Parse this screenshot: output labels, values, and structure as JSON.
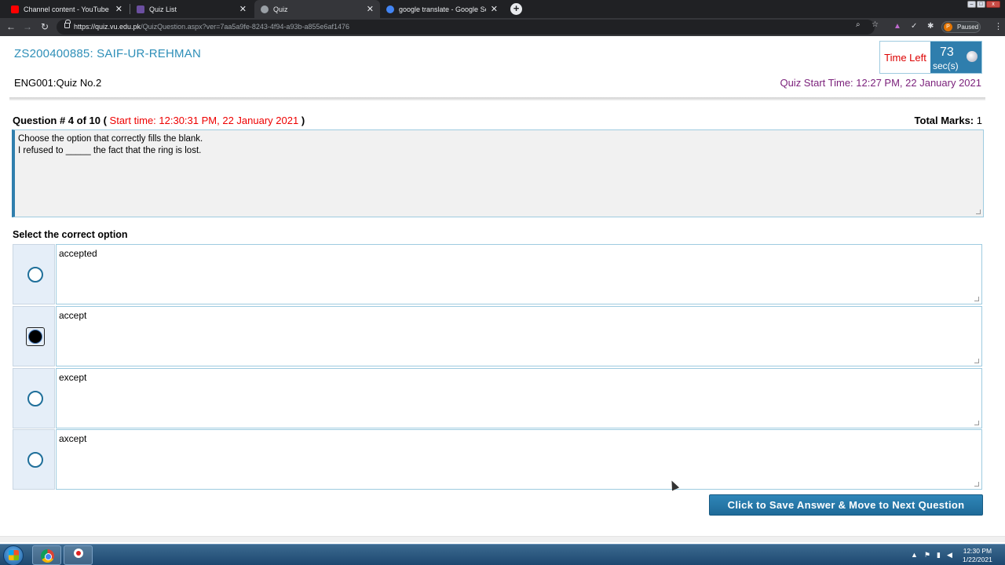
{
  "browser": {
    "tabs": [
      {
        "title": "Channel content - YouTube Studi",
        "favicon_color": "#ff0000"
      },
      {
        "title": "Quiz List",
        "favicon_color": "#6b4fa0"
      },
      {
        "title": "Quiz",
        "favicon_color": "#9aa0a6"
      },
      {
        "title": "google translate - Google Search",
        "favicon_color": "#4285f4"
      }
    ],
    "close_glyph": "✕",
    "newtab_glyph": "+",
    "url_host": "https://quiz.vu.edu.pk",
    "url_path": "/QuizQuestion.aspx?ver=7aa5a9fe-8243-4f94-a93b-a855e6af1476",
    "profile_initial": "P",
    "profile_status": "Paused"
  },
  "quiz": {
    "student": "ZS200400885: SAIF-UR-REHMAN",
    "course": "ENG001:Quiz No.2",
    "time_left_label": "Time Left",
    "time_left_value": "73",
    "time_left_unit": "sec(s)",
    "quiz_start_time": "Quiz Start Time: 12:27 PM, 22 January 2021",
    "question_header_prefix": "Question # 4 of 10 (",
    "question_start_time": "Start time: 12:30:31 PM, 22 January 2021",
    "question_header_suffix": ")",
    "total_marks_label": "Total Marks:",
    "total_marks_value": "1",
    "question_line1": "Choose the option that correctly fills the blank.",
    "question_line2": "I refused to _____ the fact that the ring is lost.",
    "select_label": "Select the correct option",
    "options": [
      {
        "text": "accepted",
        "selected": false
      },
      {
        "text": "accept",
        "selected": true
      },
      {
        "text": "except",
        "selected": false
      },
      {
        "text": "axcept",
        "selected": false
      }
    ],
    "save_button": "Click to Save Answer & Move to Next Question"
  },
  "taskbar": {
    "time": "12:30 PM",
    "date": "1/22/2021"
  }
}
